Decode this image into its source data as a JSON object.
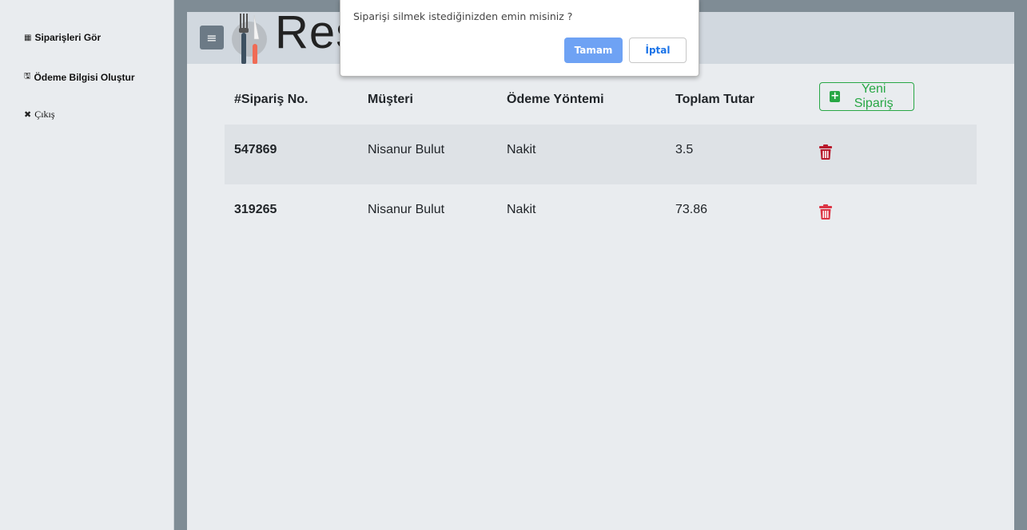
{
  "sidebar": {
    "items": [
      {
        "label": "Siparişleri Gör",
        "icon": "table-icon",
        "glyph": "▦"
      },
      {
        "label": "Ödeme Bilgisi Oluştur",
        "icon": "save-icon",
        "glyph": "🖫"
      },
      {
        "label": "Çıkış",
        "icon": "close-icon",
        "glyph": "✖"
      }
    ]
  },
  "header": {
    "menu_glyph": "≡",
    "title_visible": "Res"
  },
  "table": {
    "columns": [
      "#Sipariş No.",
      "Müşteri",
      "Ödeme Yöntemi",
      "Toplam Tutar"
    ],
    "new_order_label": "Yeni Sipariş",
    "rows": [
      {
        "order_no": "547869",
        "customer": "Nisanur Bulut",
        "payment": "Nakit",
        "total": "3.5"
      },
      {
        "order_no": "319265",
        "customer": "Nisanur Bulut",
        "payment": "Nakit",
        "total": "73.86"
      }
    ]
  },
  "dialog": {
    "message": "Siparişi silmek istediğinizden emin misiniz ?",
    "ok_label": "Tamam",
    "cancel_label": "İptal"
  },
  "colors": {
    "accent_green": "#28a745",
    "danger_red": "#dc3545",
    "dialog_ok": "#6ea2f4"
  }
}
